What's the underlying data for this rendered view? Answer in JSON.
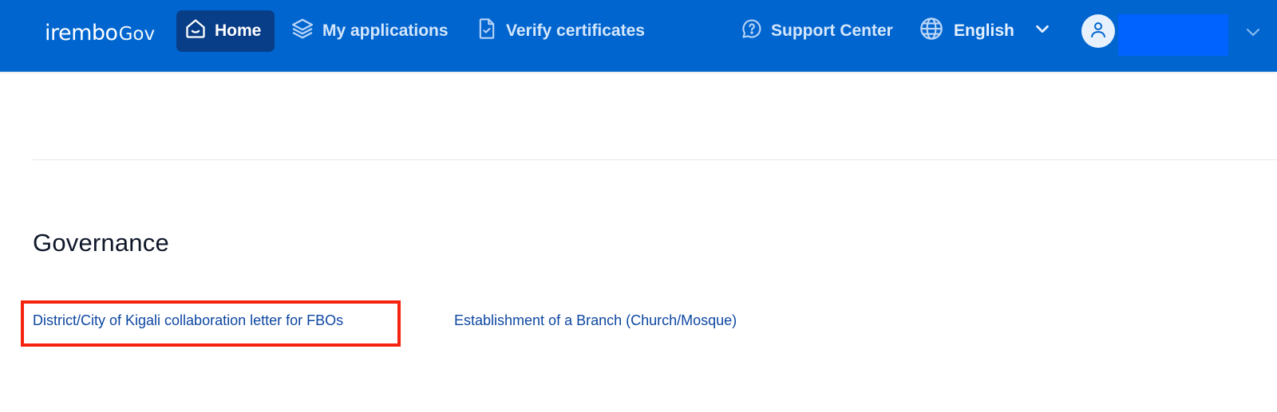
{
  "navbar": {
    "logo": {
      "brand": "irembo",
      "suffix": "Gov"
    },
    "items": [
      {
        "label": "Home",
        "icon": "home-icon",
        "active": true
      },
      {
        "label": "My applications",
        "icon": "layers-icon",
        "active": false
      },
      {
        "label": "Verify certificates",
        "icon": "file-check-icon",
        "active": false
      },
      {
        "label": "Support Center",
        "icon": "question-chat-icon",
        "active": false
      }
    ],
    "language": {
      "label": "English",
      "icon": "globe-icon"
    },
    "account": {
      "icon": "user-icon"
    }
  },
  "governance": {
    "title": "Governance",
    "links": [
      {
        "label": "District/City of Kigali collaboration letter for FBOs",
        "highlighted": true
      },
      {
        "label": "Establishment of a Branch (Church/Mosque)",
        "highlighted": false
      }
    ]
  },
  "colors": {
    "nav_bg": "#0065cf",
    "nav_active_bg": "#083d87",
    "link": "#0d47a1",
    "highlight": "#f5230f",
    "redaction": "#0062ff"
  }
}
